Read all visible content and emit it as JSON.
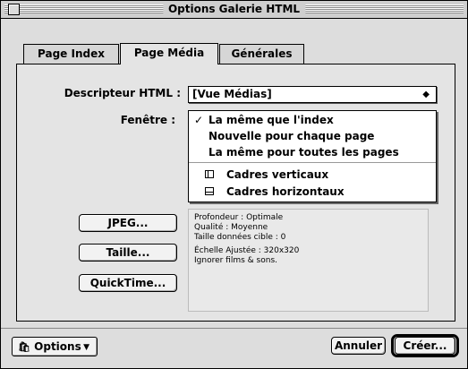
{
  "window": {
    "title": "Options Galerie HTML"
  },
  "tabs": [
    {
      "label": "Page Index"
    },
    {
      "label": "Page Média"
    },
    {
      "label": "Générales"
    }
  ],
  "form": {
    "descripteur_label": "Descripteur HTML :",
    "descripteur_value": "[Vue Médias]",
    "fenetre_label": "Fenêtre :"
  },
  "fenetre_menu": {
    "items": [
      {
        "label": "La même que l'index",
        "checked": "✓"
      },
      {
        "label": "Nouvelle pour chaque page"
      },
      {
        "label": "La même pour toutes les pages"
      },
      {
        "label": "Cadres verticaux",
        "icon": "vertical-frames-icon"
      },
      {
        "label": "Cadres horizontaux",
        "icon": "horizontal-frames-icon"
      }
    ]
  },
  "buttons": {
    "jpeg": "JPEG...",
    "taille": "Taille...",
    "quicktime": "QuickTime..."
  },
  "info": {
    "lines": [
      "Profondeur : Optimale",
      "Qualité : Moyenne",
      "Taille données cible : 0",
      "Échelle Ajustée : 320x320",
      "Ignorer films & sons."
    ]
  },
  "footer": {
    "options_label": "Options",
    "cancel_label": "Annuler",
    "create_label": "Créer..."
  }
}
